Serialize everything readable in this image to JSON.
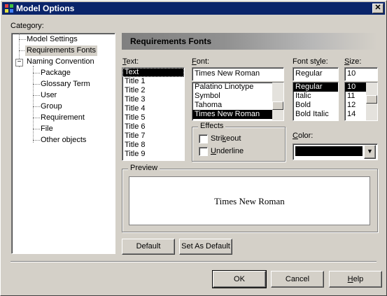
{
  "window": {
    "title": "Model Options",
    "close_label": "✕"
  },
  "category": {
    "label": "Category:",
    "items": [
      {
        "label": "Model Settings"
      },
      {
        "label": "Requirements Fonts"
      },
      {
        "label": "Naming Convention",
        "toggle": "−"
      },
      {
        "label": "Package"
      },
      {
        "label": "Glossary Term"
      },
      {
        "label": "User"
      },
      {
        "label": "Group"
      },
      {
        "label": "Requirement"
      },
      {
        "label": "File"
      },
      {
        "label": "Other objects"
      }
    ]
  },
  "panel": {
    "title": "Requirements Fonts"
  },
  "text": {
    "label": "Text:",
    "items": [
      "Text",
      "Title 1",
      "Title 2",
      "Title 3",
      "Title 4",
      "Title 5",
      "Title 6",
      "Title 7",
      "Title 8",
      "Title 9"
    ],
    "selected": "Text"
  },
  "font": {
    "label": "Font:",
    "value": "Times New Roman",
    "items": [
      "Palatino Linotype",
      "Symbol",
      "Tahoma",
      "Times New Roman"
    ],
    "selected": "Times New Roman"
  },
  "style": {
    "label": "Font style:",
    "value": "Regular",
    "items": [
      "Regular",
      "Italic",
      "Bold",
      "Bold Italic"
    ],
    "selected": "Regular"
  },
  "size": {
    "label": "Size:",
    "value": "10",
    "items": [
      "10",
      "11",
      "12",
      "14"
    ],
    "selected": "10"
  },
  "effects": {
    "label": "Effects",
    "strikeout": {
      "label": "Strikeout",
      "checked": false
    },
    "underline": {
      "label": "Underline",
      "checked": false
    }
  },
  "color": {
    "label": "Color:",
    "value": "#000000"
  },
  "preview": {
    "label": "Preview",
    "sample": "Times New Roman"
  },
  "buttons": {
    "default": "Default",
    "set_default": "Set As Default",
    "ok": "OK",
    "cancel": "Cancel",
    "help": "Help"
  },
  "icons": {
    "app": "model-options-app-icon",
    "close": "close-icon",
    "dropdown": "chevron-down-icon"
  }
}
